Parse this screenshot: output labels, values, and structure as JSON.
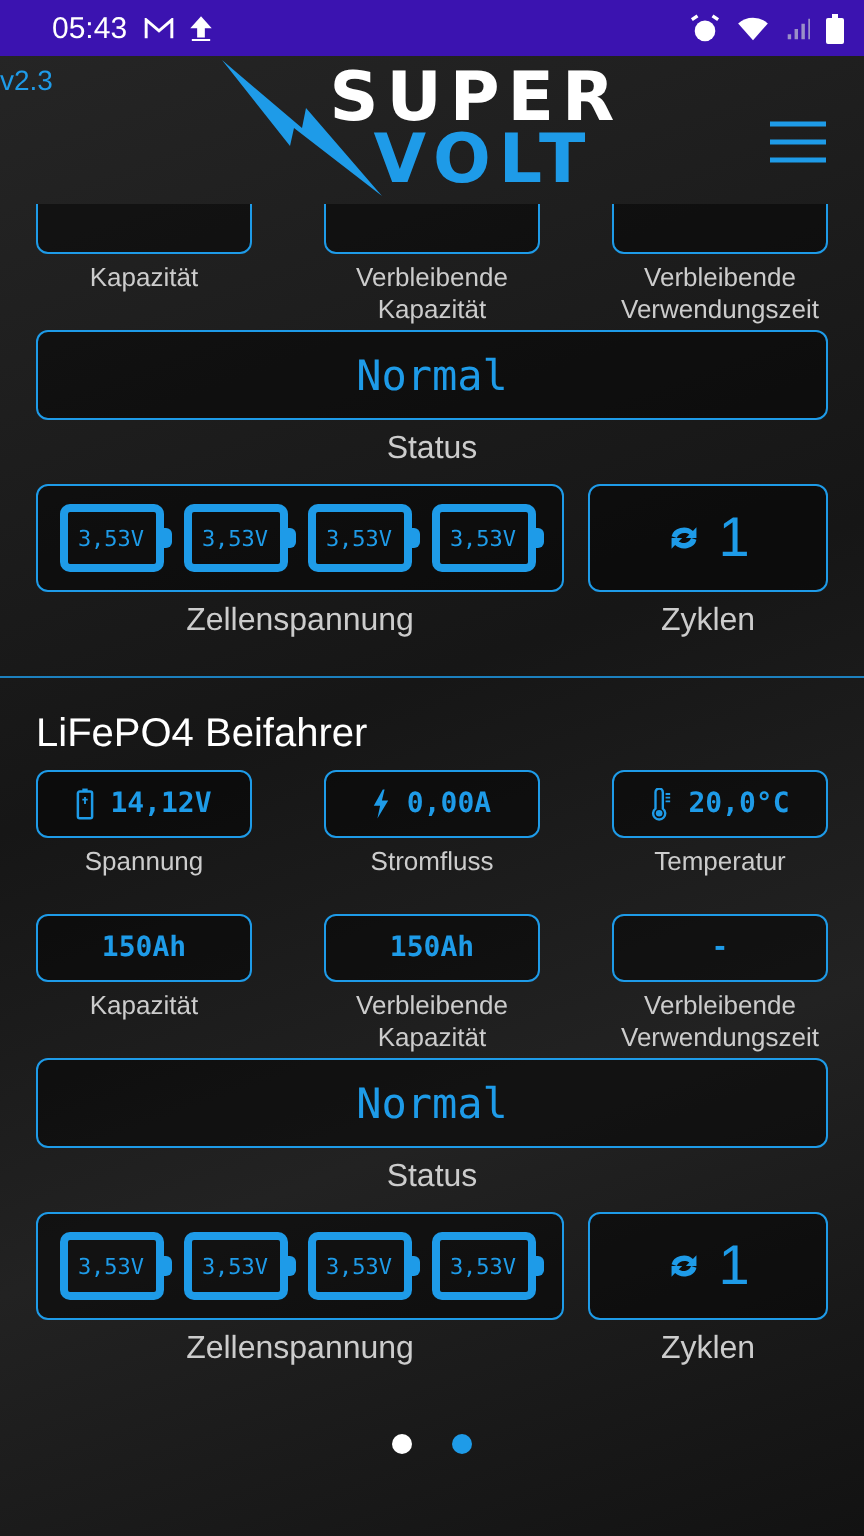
{
  "status_bar": {
    "time": "05:43"
  },
  "version": "v2.3",
  "logo": {
    "line1": "SUPER",
    "line2": "VOLT"
  },
  "sections": [
    {
      "metric_rows": [
        [
          {
            "label": "Kapazität"
          },
          {
            "label": "Verbleibende Kapazität"
          },
          {
            "label": "Verbleibende Verwendungszeit"
          }
        ]
      ],
      "status": {
        "value": "Normal",
        "label": "Status"
      },
      "cells": {
        "values": [
          "3,53V",
          "3,53V",
          "3,53V",
          "3,53V"
        ],
        "label": "Zellenspannung"
      },
      "cycles": {
        "value": "1",
        "label": "Zyklen"
      }
    },
    {
      "title": "LiFePO4 Beifahrer",
      "metric_rows": [
        [
          {
            "kind": "voltage",
            "value": "14,12V",
            "label": "Spannung"
          },
          {
            "kind": "current",
            "value": "0,00A",
            "label": "Stromfluss"
          },
          {
            "kind": "temperature",
            "value": "20,0°C",
            "label": "Temperatur"
          }
        ],
        [
          {
            "value": "150Ah",
            "label": "Kapazität"
          },
          {
            "value": "150Ah",
            "label": "Verbleibende Kapazität"
          },
          {
            "value": "-",
            "label": "Verbleibende Verwendungszeit"
          }
        ]
      ],
      "status": {
        "value": "Normal",
        "label": "Status"
      },
      "cells": {
        "values": [
          "3,53V",
          "3,53V",
          "3,53V",
          "3,53V"
        ],
        "label": "Zellenspannung"
      },
      "cycles": {
        "value": "1",
        "label": "Zyklen"
      }
    }
  ],
  "pages": [
    {
      "selected": false
    },
    {
      "selected": true
    }
  ]
}
